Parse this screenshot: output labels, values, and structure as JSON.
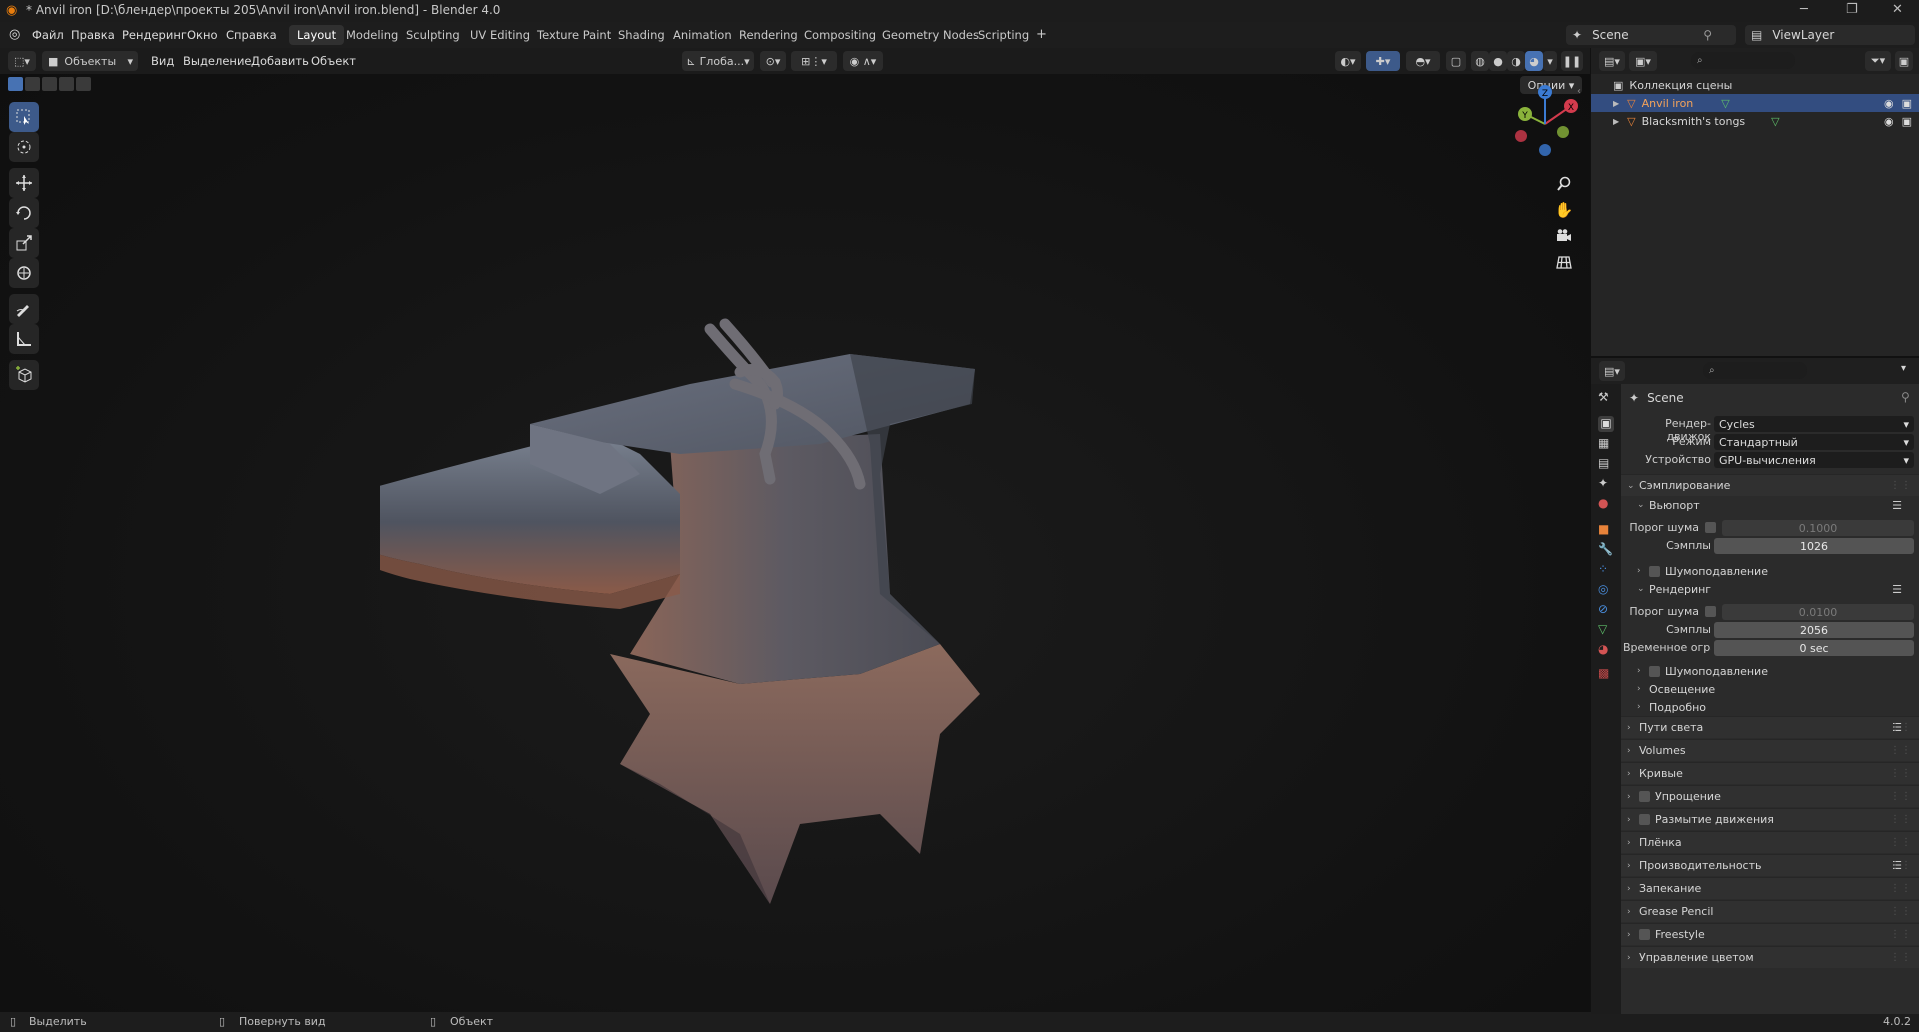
{
  "titlebar": {
    "title": "* Anvil iron [D:\\блендер\\проекты 205\\Anvil iron\\Anvil iron.blend] - Blender 4.0"
  },
  "menu": [
    "Файл",
    "Правка",
    "Рендеринг",
    "Окно",
    "Справка"
  ],
  "workspaces": [
    "Layout",
    "Modeling",
    "Sculpting",
    "UV Editing",
    "Texture Paint",
    "Shading",
    "Animation",
    "Rendering",
    "Compositing",
    "Geometry Nodes",
    "Scripting"
  ],
  "active_workspace": "Layout",
  "scene_name": "Scene",
  "view_layer": "ViewLayer",
  "viewport_header": {
    "mode": "Объекты",
    "menus": [
      "Вид",
      "Выделение",
      "Добавить",
      "Объект"
    ],
    "orientation": "Глоба...",
    "options": "Опции"
  },
  "outliner": {
    "collection": "Коллекция сцены",
    "items": [
      {
        "name": "Anvil iron",
        "selected": true
      },
      {
        "name": "Blacksmith's tongs",
        "selected": false
      }
    ]
  },
  "properties": {
    "context": "Scene",
    "render_engine_label": "Рендер-движок",
    "render_engine": "Cycles",
    "mode_label": "Режим",
    "mode": "Стандартный",
    "device_label": "Устройство",
    "device": "GPU-вычисления",
    "sampling": "Сэмплирование",
    "viewport": "Вьюпорт",
    "noise_threshold_label": "Порог шума",
    "viewport_noise_threshold": "0.1000",
    "samples_label": "Сэмплы",
    "viewport_samples": "1026",
    "denoise": "Шумоподавление",
    "render": "Рендеринг",
    "render_noise_threshold": "0.0100",
    "render_samples": "2056",
    "time_limit_label": "Временное огранич...",
    "time_limit": "0 sec",
    "render_denoise": "Шумоподавление",
    "lights": "Освещение",
    "advanced": "Подробно",
    "sections": [
      "Пути света",
      "Volumes",
      "Кривые",
      "Упрощение",
      "Размытие движения",
      "Плёнка",
      "Производительность",
      "Запекание",
      "Grease Pencil",
      "Freestyle",
      "Управление цветом"
    ]
  },
  "statusbar": {
    "select": "Выделить",
    "rotate": "Повернуть вид",
    "object": "Объект",
    "version": "4.0.2"
  },
  "gizmo": {
    "x": "X",
    "y": "Y",
    "z": "Z"
  },
  "colors": {
    "accent": "#4772b3",
    "x_axis": "#d33b4d",
    "y_axis": "#8ab33b",
    "z_axis": "#3b7bd3"
  }
}
